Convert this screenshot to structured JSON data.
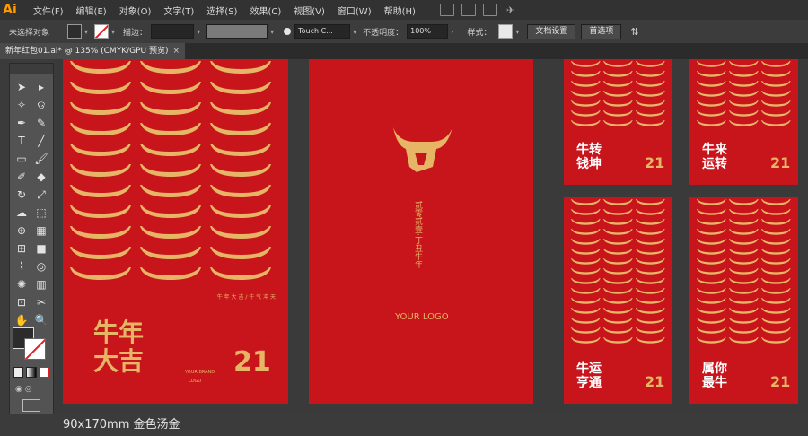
{
  "app": {
    "logo": "Ai"
  },
  "menu": [
    "文件(F)",
    "编辑(E)",
    "对象(O)",
    "文字(T)",
    "选择(S)",
    "效果(C)",
    "视图(V)",
    "窗口(W)",
    "帮助(H)"
  ],
  "menubar_icons": [
    "br-icon",
    "st-icon",
    "workspace-icon",
    "publish-icon"
  ],
  "control": {
    "no_selection": "未选择对象",
    "stroke_label": "描边：",
    "brush_name": "Touch C...",
    "opacity_label": "不透明度：",
    "opacity_value": "100%",
    "style_label": "样式：",
    "doc_setup": "文档设置",
    "preferences": "首选项"
  },
  "document_tab": {
    "title": "新年红包01.ai* @ 135% (CMYK/GPU 预览)",
    "close": "×"
  },
  "tools": [
    "selection",
    "direct-selection",
    "magic-wand",
    "lasso",
    "pen",
    "curvature",
    "type",
    "line",
    "rectangle",
    "paintbrush",
    "shaper",
    "eraser",
    "rotate",
    "scale",
    "warp",
    "free-transform",
    "shape-builder",
    "perspective",
    "mesh",
    "gradient",
    "eyedropper",
    "blend",
    "symbol-sprayer",
    "column-graph",
    "artboard",
    "slice",
    "hand",
    "zoom"
  ],
  "artboards": {
    "ab1": {
      "headline_1": "牛年",
      "headline_2": "大吉",
      "tagline": "牛 年 大 吉 / 牛 气 冲 天",
      "brand": "YOUR BRAND",
      "logo": "LOGO",
      "year": "21"
    },
    "ab2": {
      "vertical_text": "贰零贰壹·丁丑牛年",
      "logo_text": "YOUR LOGO"
    },
    "ab3": {
      "headline_1": "牛转",
      "headline_2": "钱坤",
      "year": "21"
    },
    "ab4": {
      "headline_1": "牛来",
      "headline_2": "运转",
      "year": "21"
    },
    "ab5": {
      "headline_1": "牛运",
      "headline_2": "亨通",
      "year": "21"
    },
    "ab6": {
      "headline_1": "属你",
      "headline_2": "最牛",
      "year": "21"
    }
  },
  "colors": {
    "red": "#c8141b",
    "gold": "#e6b566",
    "ui_dark": "#323232"
  },
  "status": {
    "caption": "90x170mm 金色汤金"
  }
}
